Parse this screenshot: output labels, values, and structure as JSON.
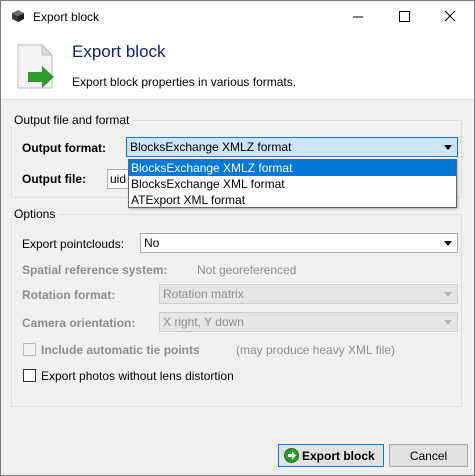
{
  "window": {
    "title": "Export block",
    "minimize_glyph": "—",
    "maximize_glyph": "□",
    "close_glyph": "✕"
  },
  "header": {
    "title": "Export block",
    "subtitle": "Export block properties in various formats.",
    "icon": "document-export-arrow-icon"
  },
  "output_group": {
    "title": "Output file and format",
    "format_label": "Output format:",
    "format_value": "BlocksExchange XMLZ format",
    "file_label": "Output file:",
    "file_value": "uid",
    "format_options": [
      "BlocksExchange XMLZ format",
      "BlocksExchange XML format",
      "ATExport XML format"
    ],
    "selected_option_index": 0
  },
  "options_group": {
    "title": "Options",
    "pointclouds_label": "Export pointclouds:",
    "pointclouds_value": "No",
    "srs_label": "Spatial reference system:",
    "srs_value": "Not georeferenced",
    "rotation_label": "Rotation format:",
    "rotation_value": "Rotation matrix",
    "camera_label": "Camera orientation:",
    "camera_value": "X right, Y down",
    "tiepoints_label": "Include automatic tie points",
    "tiepoints_note": "(may produce heavy XML file)",
    "tiepoints_checked": false,
    "photos_label": "Export photos without lens distortion",
    "photos_checked": false
  },
  "buttons": {
    "export_label": "Export block",
    "cancel_label": "Cancel"
  },
  "colors": {
    "accent": "#0078d7",
    "header_title": "#0a246a",
    "export_arrow": "#2f9a2f"
  }
}
